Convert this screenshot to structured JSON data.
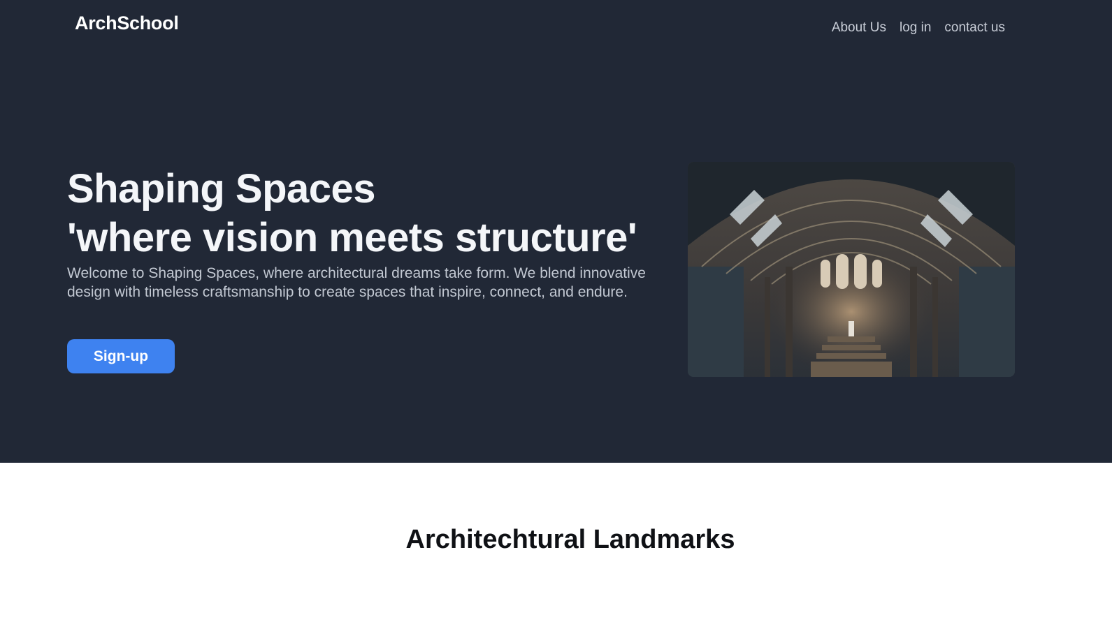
{
  "header": {
    "brand": "ArchSchool",
    "nav": [
      {
        "label": "About Us"
      },
      {
        "label": "log in"
      },
      {
        "label": "contact us"
      }
    ]
  },
  "hero": {
    "title_line1": "Shaping Spaces",
    "title_line2": "'where vision meets structure'",
    "description": "Welcome to Shaping Spaces, where architectural dreams take form. We blend innovative design with timeless craftsmanship to create spaces that inspire, connect, and endure.",
    "cta_label": "Sign-up",
    "image_icon": "arched-hall-image"
  },
  "landmarks": {
    "title": "Architechtural Landmarks"
  },
  "colors": {
    "hero_background": "#212836",
    "button": "#3e82f0",
    "page_background": "#ffffff"
  }
}
